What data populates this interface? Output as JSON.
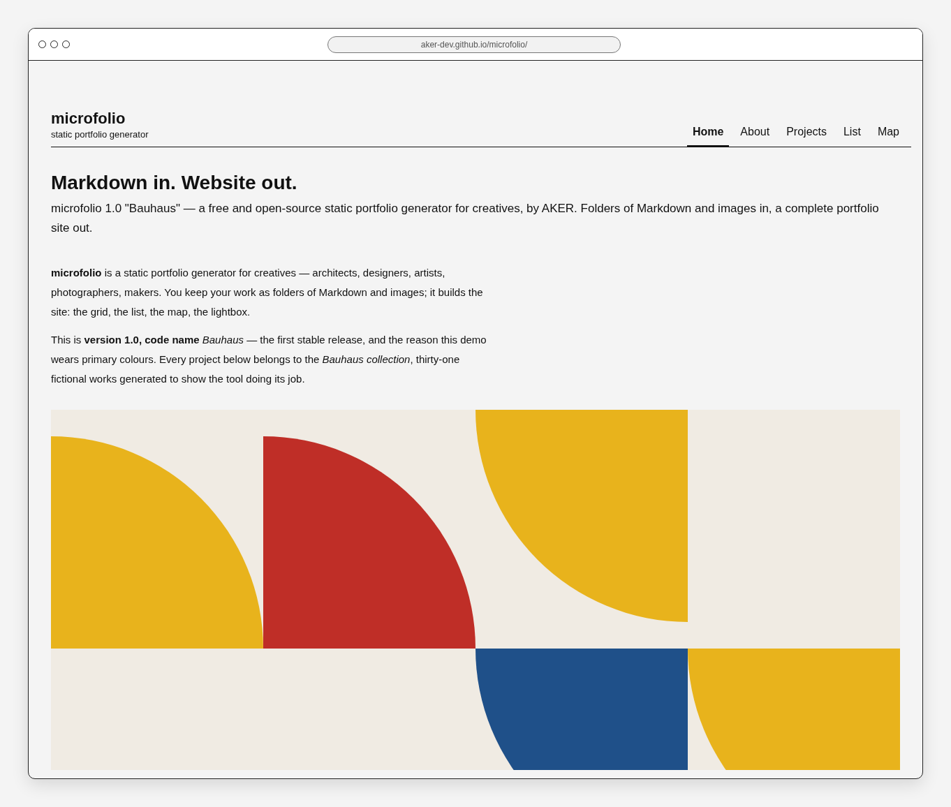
{
  "browser": {
    "url": "aker-dev.github.io/microfolio/"
  },
  "site": {
    "title": "microfolio",
    "tagline": "static portfolio generator"
  },
  "nav": [
    {
      "label": "Home",
      "selected": true
    },
    {
      "label": "About",
      "selected": false
    },
    {
      "label": "Projects",
      "selected": false
    },
    {
      "label": "List",
      "selected": false
    },
    {
      "label": "Map",
      "selected": false
    }
  ],
  "hero": {
    "heading": "Markdown in. Website out.",
    "lead": "microfolio 1.0 \"Bauhaus\" — a free and open-source static portfolio generator for creatives, by AKER. Folders of Markdown and images in, a complete portfolio site out."
  },
  "intro": [
    "**microfolio** is a static portfolio generator for creatives — architects, designers, artists, photographers, makers. You keep your work as folders of Markdown and images; it builds the site: the grid, the list, the map, the lightbox.",
    "This is **version 1.0, code name** *Bauhaus* — the first stable release, and the reason this demo wears primary colours. Every project below belongs to the *Bauhaus collection*, thirty-one fictional works generated to show the tool doing its job."
  ]
}
